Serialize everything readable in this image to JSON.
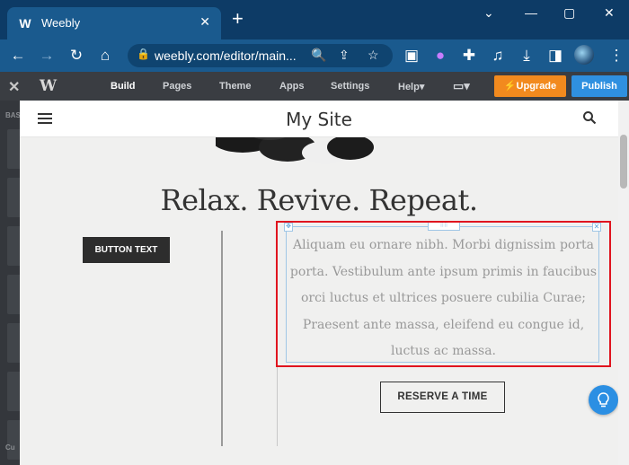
{
  "browser": {
    "tab_title": "Weebly",
    "tab_favicon": "W",
    "new_tab": "+",
    "url": "weebly.com/editor/main...",
    "window_controls": [
      "⌄",
      "—",
      "▢",
      "✕"
    ]
  },
  "editor": {
    "close_icon": "✕",
    "logo": "W",
    "nav": [
      "Build",
      "Pages",
      "Theme",
      "Apps",
      "Settings",
      "Help▾"
    ],
    "device_toggle": "▭▾",
    "upgrade_label": "⚡Upgrade",
    "publish_label": "Publish",
    "sidebar_label": "BAS",
    "sidebar_bottom_label": "Cu"
  },
  "site": {
    "title": "My Site",
    "hero_title": "Relax. Revive. Repeat.",
    "button_text": "BUTTON TEXT",
    "paragraph": "Aliquam eu ornare nibh. Morbi dignissim porta porta. Vestibulum ante ipsum primis in faucibus orci luctus et ultrices posuere cubilia Curae; Praesent ante massa, eleifend eu congue id, luctus ac massa.",
    "reserve_button": "RESERVE A TIME"
  },
  "colors": {
    "highlight": "#e0141e",
    "upgrade": "#f28a1e",
    "publish": "#2f90e0",
    "browser_chrome": "#1a5a8e"
  }
}
